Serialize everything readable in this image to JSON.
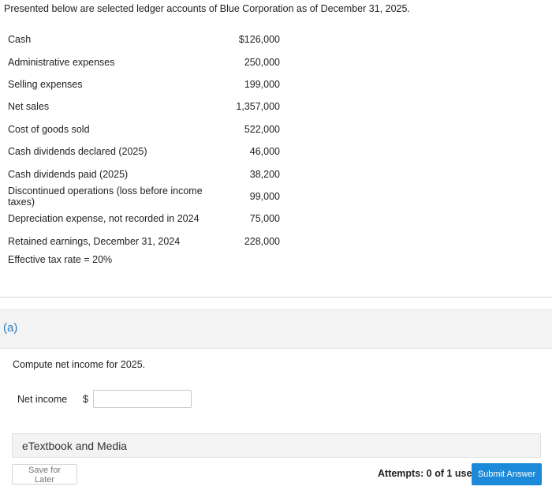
{
  "intro": "Presented below are selected ledger accounts of Blue Corporation as of December 31, 2025.",
  "ledger": [
    {
      "account": "Cash",
      "amount": "$126,000"
    },
    {
      "account": "Administrative expenses",
      "amount": "250,000"
    },
    {
      "account": "Selling expenses",
      "amount": "199,000"
    },
    {
      "account": "Net sales",
      "amount": "1,357,000"
    },
    {
      "account": "Cost of goods sold",
      "amount": "522,000"
    },
    {
      "account": "Cash dividends declared (2025)",
      "amount": "46,000"
    },
    {
      "account": "Cash dividends paid (2025)",
      "amount": "38,200"
    },
    {
      "account": "Discontinued operations (loss before income taxes)",
      "amount": "99,000"
    },
    {
      "account": "Depreciation expense, not recorded in 2024",
      "amount": "75,000"
    },
    {
      "account": "Retained earnings, December 31, 2024",
      "amount": "228,000"
    }
  ],
  "tax_rate_text": "Effective tax rate = 20%",
  "part": {
    "label": "(a)",
    "question": "Compute net income for 2025.",
    "field_label": "Net income",
    "currency": "$",
    "input_value": ""
  },
  "etextbook_label": "eTextbook and Media",
  "footer": {
    "save_label": "Save for Later",
    "attempts": "Attempts: 0 of 1 used",
    "submit_label": "Submit Answer"
  },
  "colors": {
    "accent": "#1c8ad9",
    "section_label": "#2a7fc4"
  }
}
